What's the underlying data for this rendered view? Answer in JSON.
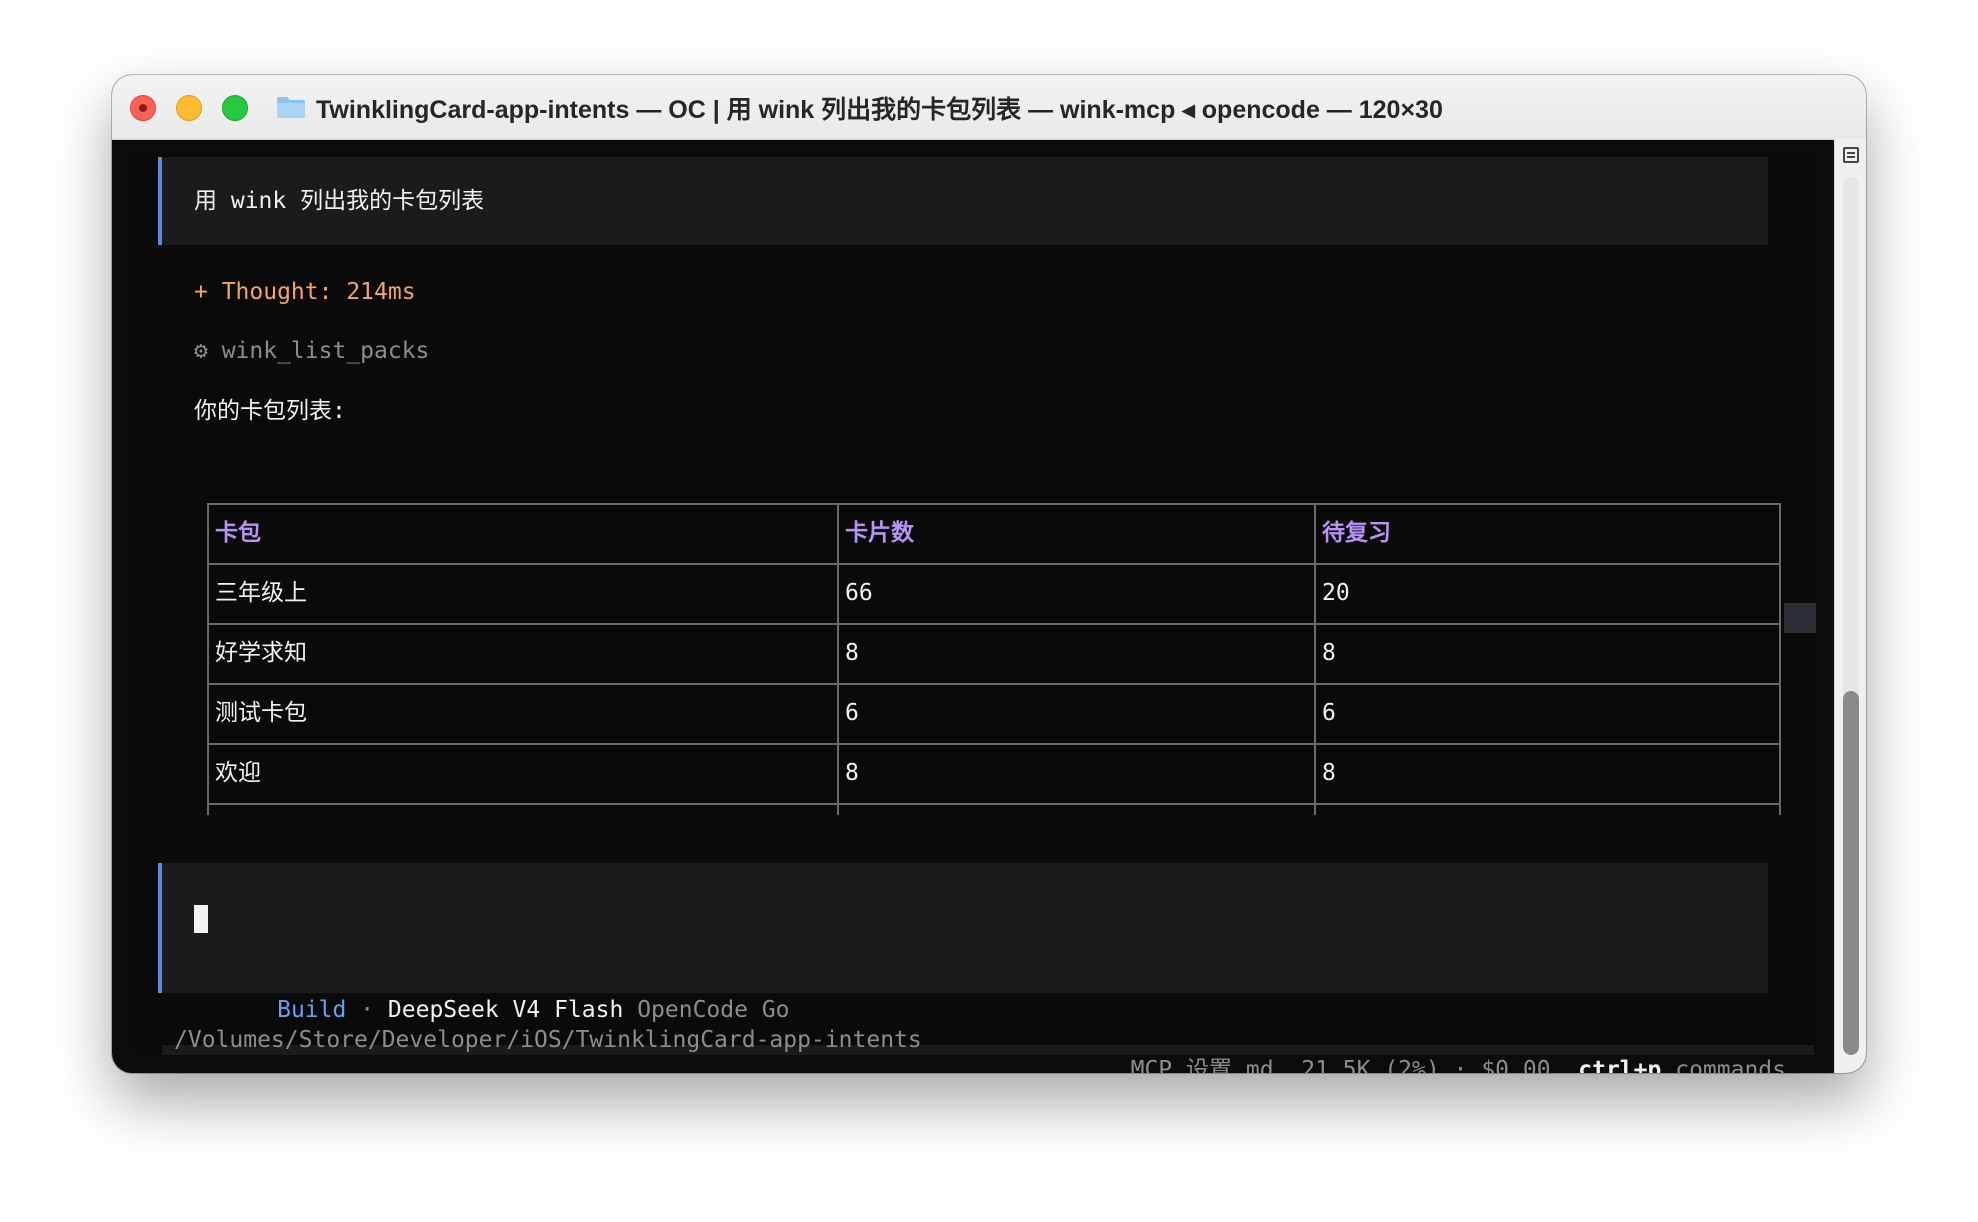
{
  "window": {
    "title": "TwinklingCard-app-intents — OC | 用 wink 列出我的卡包列表 — wink-mcp ◂ opencode — 120×30",
    "folder_icon": "folder-icon"
  },
  "conversation": {
    "user_prompt": "用 wink 列出我的卡包列表",
    "thought": "+ Thought: 214ms",
    "tool_call": "⚙ wink_list_packs",
    "response_intro": "你的卡包列表:"
  },
  "table": {
    "headers": [
      "卡包",
      "卡片数",
      "待复习"
    ],
    "rows": [
      [
        "三年级上",
        "66",
        "20"
      ],
      [
        "好学求知",
        "8",
        "8"
      ],
      [
        "测试卡包",
        "6",
        "6"
      ],
      [
        "欢迎",
        "8",
        "8"
      ]
    ]
  },
  "input": {
    "mode": "Build",
    "separator": "·",
    "model": "DeepSeek V4 Flash",
    "provider": "OpenCode Go"
  },
  "status_bar": {
    "path": "/Volumes/Store/Developer/iOS/TwinklingCard-app-intents",
    "mcp": "MCP 设置.md",
    "tokens": "21.5K (2%)",
    "dot": "·",
    "cost": "$0.00",
    "shortcut_key": "ctrl+p",
    "shortcut_label": "commands"
  },
  "colors": {
    "accent_blue": "#5a8be0",
    "thought_orange": "#f5a65b",
    "header_purple": "#b794f4",
    "terminal_bg": "#0a0a0a"
  }
}
